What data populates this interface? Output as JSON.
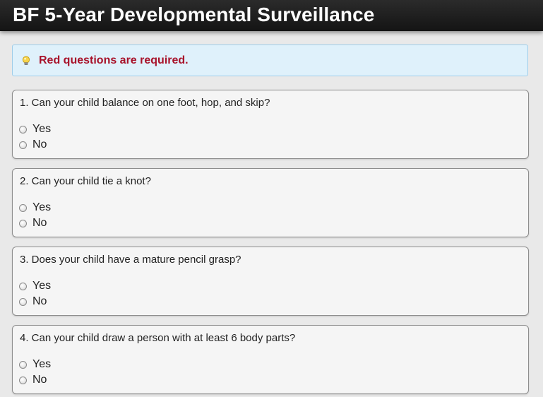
{
  "header": {
    "title": "BF 5-Year Developmental Surveillance"
  },
  "notice": {
    "icon": "lightbulb-icon",
    "text": "Red questions are required."
  },
  "questions": [
    {
      "text": "1. Can your child balance on one foot, hop, and skip?",
      "options": [
        "Yes",
        "No"
      ],
      "selected": null
    },
    {
      "text": "2. Can your child tie a knot?",
      "options": [
        "Yes",
        "No"
      ],
      "selected": null
    },
    {
      "text": "3. Does your child have a mature pencil grasp?",
      "options": [
        "Yes",
        "No"
      ],
      "selected": null
    },
    {
      "text": "4. Can your child draw a person with at least 6 body parts?",
      "options": [
        "Yes",
        "No"
      ],
      "selected": null
    }
  ],
  "colors": {
    "header_bg": "#1f1f1f",
    "notice_bg": "#dff1fb",
    "required_text": "#a8122a",
    "card_bg": "#f5f5f5",
    "page_bg": "#e9e9e9"
  }
}
